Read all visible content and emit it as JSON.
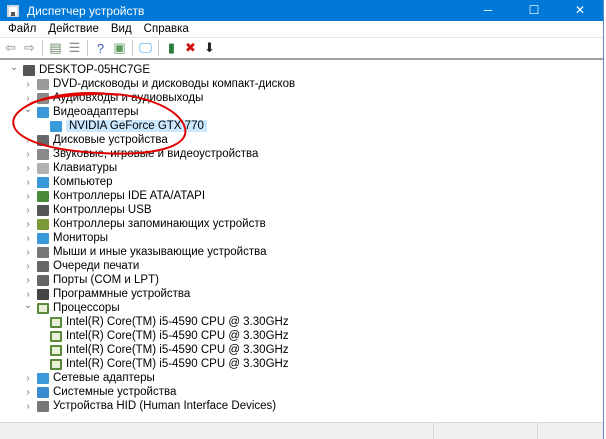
{
  "window": {
    "title": "Диспетчер устройств",
    "minimize": "─",
    "maximize": "☐",
    "close": "✕"
  },
  "menu": [
    "Файл",
    "Действие",
    "Вид",
    "Справка"
  ],
  "toolbar": [
    {
      "icon": "back-arrow-icon",
      "glyph": "⇦"
    },
    {
      "icon": "forward-arrow-icon",
      "glyph": "⇨"
    },
    {
      "icon": "properties-pane-icon",
      "glyph": "▤"
    },
    {
      "icon": "list-icon",
      "glyph": "☰"
    },
    {
      "icon": "help-icon",
      "glyph": "?"
    },
    {
      "icon": "action-pane-icon",
      "glyph": "▣"
    },
    {
      "icon": "scan-hardware-icon",
      "glyph": "🖵"
    },
    {
      "icon": "add-driver-icon",
      "glyph": "▮"
    },
    {
      "icon": "uninstall-icon",
      "glyph": "✖"
    },
    {
      "icon": "update-driver-icon",
      "glyph": "⬇"
    }
  ],
  "tree": [
    {
      "label": "DESKTOP-05HC7GE",
      "level": 0,
      "expand": "open",
      "icon": "computer-root-icon",
      "color": "#555"
    },
    {
      "label": "DVD-дисководы и дисководы компакт-дисков",
      "level": 1,
      "expand": "closed",
      "icon": "dvd-icon",
      "color": "#9a9a9a"
    },
    {
      "label": "Аудиовходы и аудиовыходы",
      "level": 1,
      "expand": "closed",
      "icon": "speaker-icon",
      "color": "#8a8a8a"
    },
    {
      "label": "Видеоадаптеры",
      "level": 1,
      "expand": "open",
      "icon": "display-adapter-icon",
      "color": "#3a9ad9"
    },
    {
      "label": "NVIDIA GeForce GTX 770",
      "level": 2,
      "expand": "",
      "icon": "display-adapter-icon",
      "color": "#3a9ad9",
      "selected": true
    },
    {
      "label": "Дисковые устройства",
      "level": 1,
      "expand": "closed",
      "icon": "disk-drive-icon",
      "color": "#666"
    },
    {
      "label": "Звуковые, игровые и видеоустройства",
      "level": 1,
      "expand": "closed",
      "icon": "sound-icon",
      "color": "#8a8a8a"
    },
    {
      "label": "Клавиатуры",
      "level": 1,
      "expand": "closed",
      "icon": "keyboard-icon",
      "color": "#b0b0b0"
    },
    {
      "label": "Компьютер",
      "level": 1,
      "expand": "closed",
      "icon": "computer-icon",
      "color": "#3a9ad9"
    },
    {
      "label": "Контроллеры IDE ATA/ATAPI",
      "level": 1,
      "expand": "closed",
      "icon": "ide-controller-icon",
      "color": "#4a8a3a"
    },
    {
      "label": "Контроллеры USB",
      "level": 1,
      "expand": "closed",
      "icon": "usb-icon",
      "color": "#555"
    },
    {
      "label": "Контроллеры запоминающих устройств",
      "level": 1,
      "expand": "closed",
      "icon": "storage-controller-icon",
      "color": "#7a9a3a"
    },
    {
      "label": "Мониторы",
      "level": 1,
      "expand": "closed",
      "icon": "monitor-icon",
      "color": "#3a9ad9"
    },
    {
      "label": "Мыши и иные указывающие устройства",
      "level": 1,
      "expand": "closed",
      "icon": "mouse-icon",
      "color": "#777"
    },
    {
      "label": "Очереди печати",
      "level": 1,
      "expand": "closed",
      "icon": "printer-icon",
      "color": "#666"
    },
    {
      "label": "Порты (COM и LPT)",
      "level": 1,
      "expand": "closed",
      "icon": "port-icon",
      "color": "#666"
    },
    {
      "label": "Программные устройства",
      "level": 1,
      "expand": "closed",
      "icon": "software-device-icon",
      "color": "#444"
    },
    {
      "label": "Процессоры",
      "level": 1,
      "expand": "open",
      "icon": "processor-icon",
      "color": "#5a8a3a"
    },
    {
      "label": "Intel(R) Core(TM) i5-4590 CPU @ 3.30GHz",
      "level": 2,
      "expand": "",
      "icon": "processor-icon",
      "color": "#5a8a3a"
    },
    {
      "label": "Intel(R) Core(TM) i5-4590 CPU @ 3.30GHz",
      "level": 2,
      "expand": "",
      "icon": "processor-icon",
      "color": "#5a8a3a"
    },
    {
      "label": "Intel(R) Core(TM) i5-4590 CPU @ 3.30GHz",
      "level": 2,
      "expand": "",
      "icon": "processor-icon",
      "color": "#5a8a3a"
    },
    {
      "label": "Intel(R) Core(TM) i5-4590 CPU @ 3.30GHz",
      "level": 2,
      "expand": "",
      "icon": "processor-icon",
      "color": "#5a8a3a"
    },
    {
      "label": "Сетевые адаптеры",
      "level": 1,
      "expand": "closed",
      "icon": "network-adapter-icon",
      "color": "#3a9ad9"
    },
    {
      "label": "Системные устройства",
      "level": 1,
      "expand": "closed",
      "icon": "system-device-icon",
      "color": "#3a8ad0"
    },
    {
      "label": "Устройства HID (Human Interface Devices)",
      "level": 1,
      "expand": "closed",
      "icon": "hid-icon",
      "color": "#777"
    }
  ],
  "annotation_color": "#e00000"
}
